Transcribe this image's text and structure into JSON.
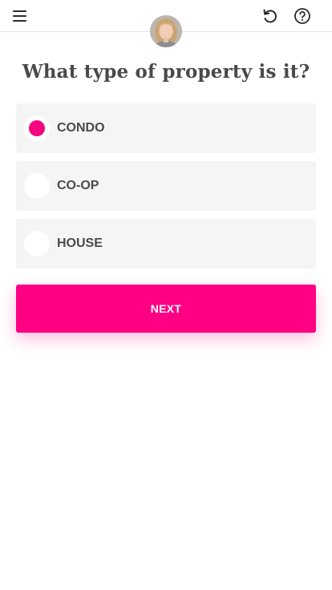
{
  "header": {
    "menu_icon": "hamburger-menu-icon",
    "undo_icon": "undo-icon",
    "help_icon": "help-circle-icon",
    "avatar_alt": "agent-avatar"
  },
  "question": "What type of property is it?",
  "options": [
    {
      "label": "CONDO",
      "selected": true
    },
    {
      "label": "CO-OP",
      "selected": false
    },
    {
      "label": "HOUSE",
      "selected": false
    }
  ],
  "next_button": {
    "label": "NEXT"
  },
  "colors": {
    "accent": "#ff0084",
    "radio_selected": "#f5077f",
    "option_bg": "#f5f5f5",
    "text": "#4a4a4a"
  }
}
